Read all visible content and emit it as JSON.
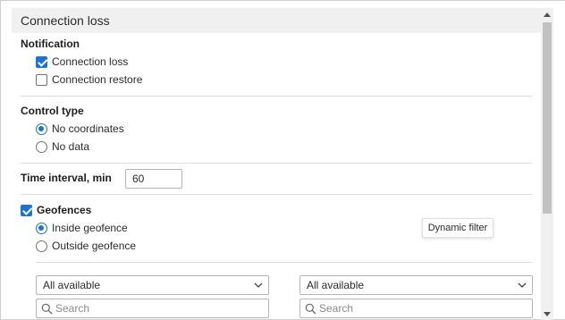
{
  "header": {
    "title": "Connection loss"
  },
  "notification": {
    "title": "Notification",
    "options": [
      {
        "label": "Connection loss",
        "checked": true
      },
      {
        "label": "Connection restore",
        "checked": false
      }
    ]
  },
  "control_type": {
    "title": "Control type",
    "options": [
      {
        "label": "No coordinates",
        "selected": true
      },
      {
        "label": "No data",
        "selected": false
      }
    ]
  },
  "time_interval": {
    "label": "Time interval, min",
    "value": "60"
  },
  "geofences": {
    "label": "Geofences",
    "checked": true,
    "options": [
      {
        "label": "Inside geofence",
        "selected": true
      },
      {
        "label": "Outside geofence",
        "selected": false
      }
    ],
    "tooltip": "Dynamic filter",
    "left_select": {
      "value": "All available"
    },
    "right_select": {
      "value": "All available"
    },
    "left_search": {
      "placeholder": "Search"
    },
    "right_search": {
      "placeholder": "Search"
    }
  },
  "icons": {
    "checkbox": "check-icon",
    "select_arrow": "chevron-down-icon",
    "search": "search-icon"
  },
  "colors": {
    "accent": "#1a73d9",
    "header_bg": "#f0f0f0",
    "divider": "#dcdcdc"
  }
}
